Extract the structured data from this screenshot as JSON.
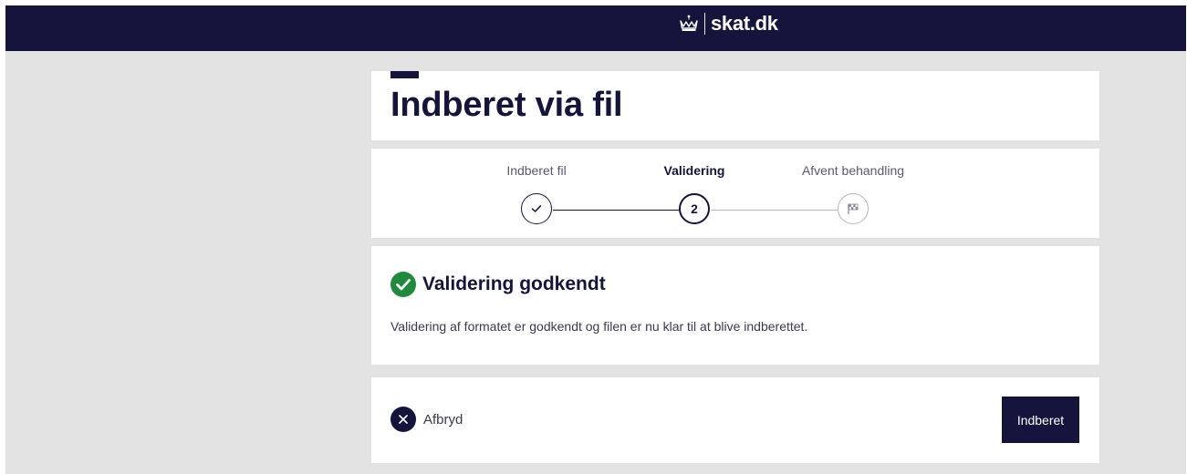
{
  "header": {
    "brand": "skat.dk",
    "logo_icon": "crown-icon"
  },
  "page": {
    "title": "Indberet via fil"
  },
  "steps": [
    {
      "label": "Indberet fil",
      "state": "done",
      "icon": "check-icon"
    },
    {
      "label": "Validering",
      "state": "active",
      "number": "2"
    },
    {
      "label": "Afvent behandling",
      "state": "todo",
      "icon": "checkered-flag-icon"
    }
  ],
  "status": {
    "icon": "check-circle-icon",
    "title": "Validering godkendt",
    "message": "Validering af formatet er godkendt og filen er nu klar til at blive indberettet."
  },
  "actions": {
    "cancel_label": "Afbryd",
    "cancel_icon": "close-icon",
    "submit_label": "Indberet"
  },
  "colors": {
    "primary": "#14143c",
    "success": "#1f8a3b",
    "background": "#e3e3e3",
    "muted": "#b5b5b5"
  }
}
